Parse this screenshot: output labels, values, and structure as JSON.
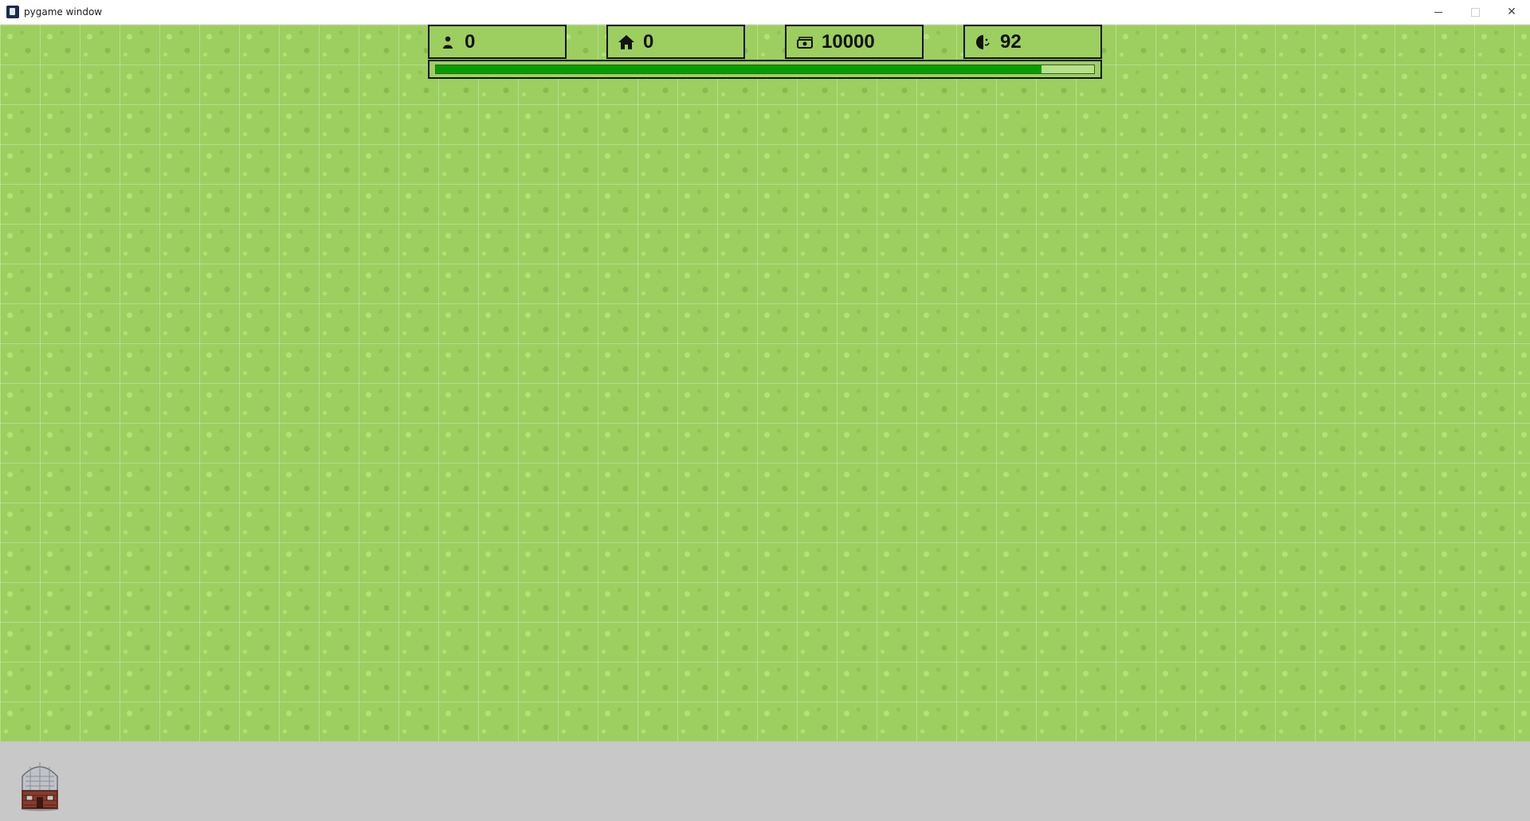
{
  "window": {
    "title": "pygame window",
    "controls": [
      "minimize",
      "maximize",
      "close"
    ]
  },
  "hud": {
    "population": {
      "icon": "person-icon",
      "value": "0"
    },
    "houses": {
      "icon": "house-icon",
      "value": "0"
    },
    "money": {
      "icon": "money-stack-icon",
      "value": "10000"
    },
    "happiness": {
      "icon": "smile-face-icon",
      "value": "92"
    }
  },
  "progress": {
    "fraction": 0.92,
    "color": "#019e01"
  },
  "map": {
    "tile": "grass",
    "grass_color": "#9ccf5f"
  },
  "build_panel": {
    "background": "#c8c8c8",
    "items": [
      {
        "icon": "house-building-icon"
      }
    ]
  }
}
